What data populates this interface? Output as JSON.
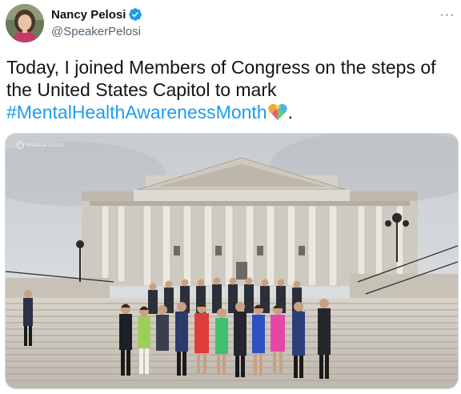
{
  "tweet": {
    "author": {
      "name": "Nancy Pelosi",
      "handle": "@SpeakerPelosi",
      "verified": true
    },
    "text": {
      "line1": "Today, I joined Members of Congress on the steps of",
      "line2": "the United States Capitol to mark",
      "hashtag": "#MentalHealthAwarenessMonth",
      "trailing": "."
    },
    "more_label": "···",
    "image": {
      "watermark": "SPEAKER PELOSI",
      "description_icon": "photo"
    }
  },
  "colors": {
    "link": "#1d9bf0",
    "verified": "#1d9bf0",
    "text": "#0f1419",
    "secondary": "#536471"
  }
}
